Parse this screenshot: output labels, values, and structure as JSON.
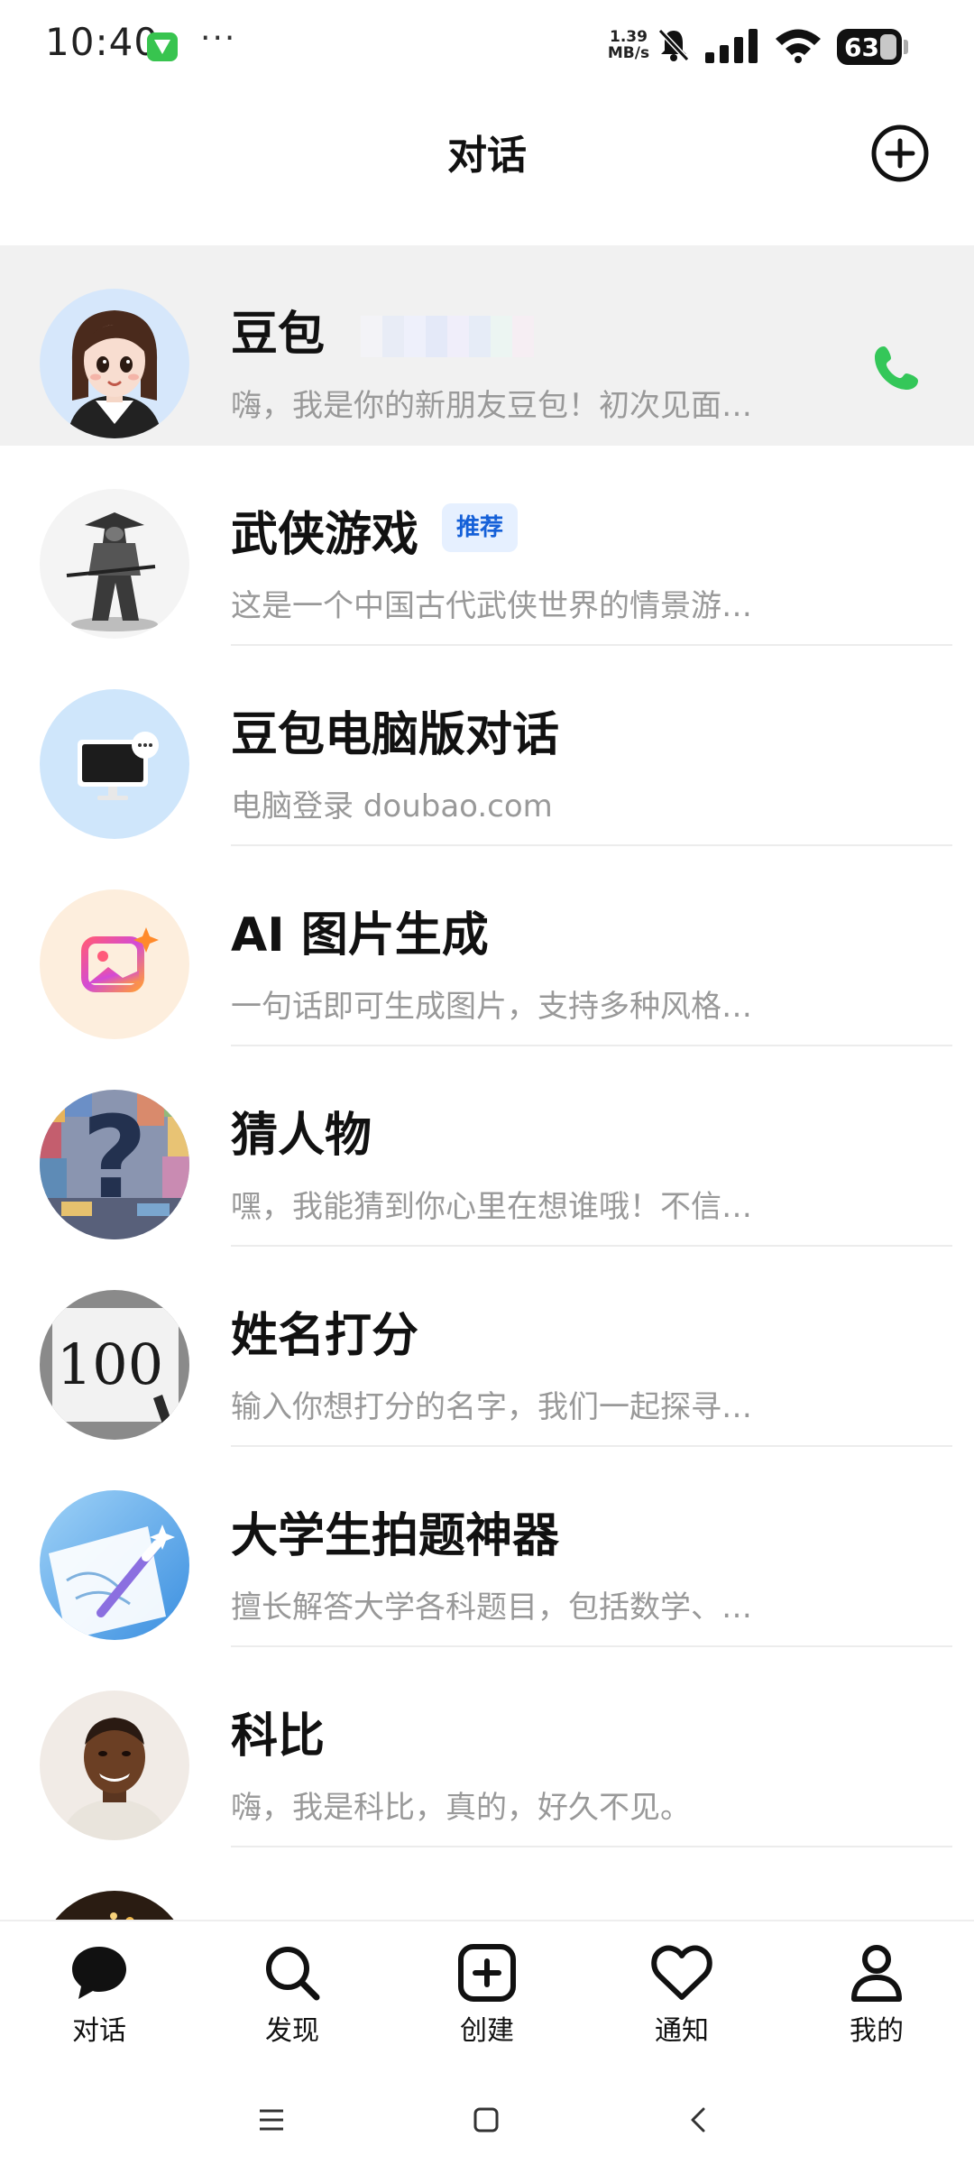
{
  "status_bar": {
    "time": "10:40",
    "app_icon": "green-shield-icon",
    "more": "···",
    "net_speed_value": "1.39",
    "net_speed_unit": "MB/s",
    "battery": "63"
  },
  "header": {
    "title": "对话",
    "add_icon": "plus-circle-icon"
  },
  "chats": [
    {
      "title": "豆包",
      "subtitle": "嗨，我是你的新朋友豆包！初次见面…",
      "has_call": true
    },
    {
      "title": "武侠游戏",
      "badge": "推荐",
      "subtitle": "这是一个中国古代武侠世界的情景游…"
    },
    {
      "title": "豆包电脑版对话",
      "subtitle": "电脑登录 doubao.com"
    },
    {
      "title": "AI 图片生成",
      "subtitle": "一句话即可生成图片，支持多种风格…"
    },
    {
      "title": "猜人物",
      "subtitle": "嘿，我能猜到你心里在想谁哦！不信…"
    },
    {
      "title": "姓名打分",
      "subtitle": "输入你想打分的名字，我们一起探寻…"
    },
    {
      "title": "大学生拍题神器",
      "subtitle": "擅长解答大学各科题目，包括数学、…"
    },
    {
      "title": "科比",
      "subtitle": "嗨，我是科比，真的，好久不见。"
    }
  ],
  "avatar_text": {
    "score": "100",
    "question": "?"
  },
  "bottom_nav": [
    {
      "label": "对话",
      "icon": "chat-bubble-icon",
      "active": true
    },
    {
      "label": "发现",
      "icon": "search-icon"
    },
    {
      "label": "创建",
      "icon": "create-plus-square-icon"
    },
    {
      "label": "通知",
      "icon": "heart-icon"
    },
    {
      "label": "我的",
      "icon": "person-icon"
    }
  ],
  "colors": {
    "accent_green": "#34c759",
    "badge_blue": "#1560d8",
    "highlight_row": "#f1f1f1",
    "subtitle_gray": "#999999"
  }
}
